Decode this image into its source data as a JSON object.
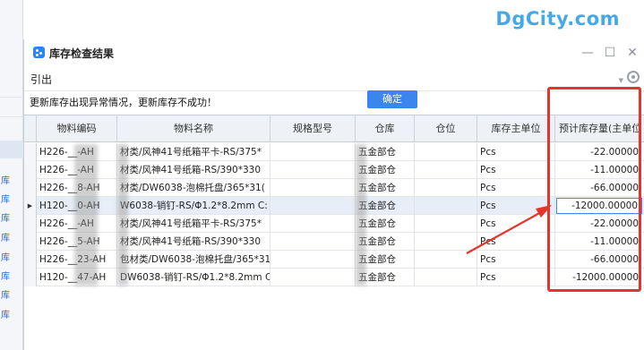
{
  "watermark": "DgCity.com",
  "background": {
    "left_items": [
      "库",
      "库",
      "库",
      "库",
      "库",
      "库",
      "库",
      "库"
    ]
  },
  "window": {
    "title": "库存检查结果",
    "minimize": "—",
    "maximize": "☐",
    "close": "✕"
  },
  "toolbar": {
    "export_label": "引出"
  },
  "message": "更新库存出现异常情况，更新库存不成功！",
  "confirm_label": "确定",
  "table": {
    "columns": [
      "物料编码",
      "物料名称",
      "规格型号",
      "仓库",
      "仓位",
      "库存主单位",
      "预计库存量(主单位"
    ],
    "rows": [
      {
        "code": "H226-__-AH",
        "name": "材类/风神41号纸箱平卡-RS/375*",
        "spec": "",
        "warehouse": "五金部仓",
        "location": "",
        "unit": "Pcs",
        "qty": "-22.00000"
      },
      {
        "code": "H226-__-AH",
        "name": "材类/风神41号纸箱-RS/390*330",
        "spec": "",
        "warehouse": "五金部仓",
        "location": "",
        "unit": "Pcs",
        "qty": "-11.00000"
      },
      {
        "code": "H226-__8-AH",
        "name": "材类/DW6038-泡棉托盘/365*31(",
        "spec": "",
        "warehouse": "五金部仓",
        "location": "",
        "unit": "Pcs",
        "qty": "-66.00000"
      },
      {
        "code": "H120-__0-AH",
        "name": "W6038-销钉-RS/Φ1.2*8.2mm C:",
        "spec": "",
        "warehouse": "五金部仓",
        "location": "",
        "unit": "Pcs",
        "qty": "-12000.00000"
      },
      {
        "code": "H226-__-AH",
        "name": "材类/风神41号纸箱平卡-RS/375*",
        "spec": "",
        "warehouse": "五金部仓",
        "location": "",
        "unit": "Pcs",
        "qty": "-22.00000"
      },
      {
        "code": "H226-__5-AH",
        "name": "材类/风神41号纸箱-RS/390*330",
        "spec": "",
        "warehouse": "五金部仓",
        "location": "",
        "unit": "Pcs",
        "qty": "-11.00000"
      },
      {
        "code": "H226-__23-AH",
        "name": "包材类/DW6038-泡棉托盘/365*31(",
        "spec": "",
        "warehouse": "五金部仓",
        "location": "",
        "unit": "Pcs",
        "qty": "-66.00000"
      },
      {
        "code": "H120-__47-AH",
        "name": "DW6038-销钉-RS/Φ1.2*8.2mm C:",
        "spec": "",
        "warehouse": "五金部仓",
        "location": "",
        "unit": "Pcs",
        "qty": "-12000.00000"
      }
    ],
    "selected_row_marker": "▶"
  },
  "colors": {
    "accent": "#3a86ee",
    "annotation": "#e5342b",
    "watermark": "#47a8e6"
  }
}
